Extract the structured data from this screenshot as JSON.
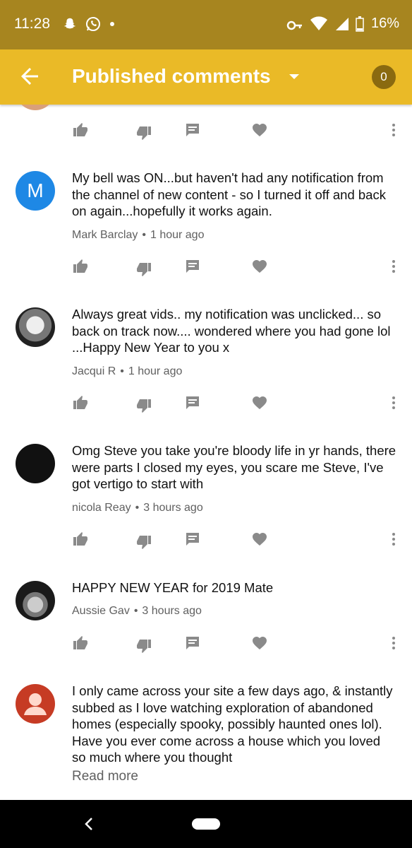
{
  "status_bar": {
    "time": "11:28",
    "battery": "16%"
  },
  "app_bar": {
    "title": "Published comments",
    "count": "0"
  },
  "comments": [
    {
      "initial": "M",
      "text": "My bell was ON...but haven't had any notification from the channel of new content - so I turned it off and back on again...hopefully it works again.",
      "author": "Mark Barclay",
      "time": "1 hour ago"
    },
    {
      "text": "Always great vids.. my notification was unclicked... so back on track now.... wondered where you had gone lol ...Happy New Year to you x",
      "author": "Jacqui R",
      "time": "1 hour ago"
    },
    {
      "text": "Omg Steve you take you're bloody life in yr hands, there were parts I closed my eyes, you scare me Steve, I've got vertigo to start with",
      "author": "nicola Reay",
      "time": "3 hours ago"
    },
    {
      "text": "HAPPY NEW YEAR  for 2019 Mate",
      "author": "Aussie Gav",
      "time": "3 hours ago"
    },
    {
      "text": "I only came across your site a few days ago, & instantly subbed as I love watching exploration of abandoned homes (especially spooky, possibly haunted ones lol). Have you ever come across a house which you loved so much where you thought",
      "read_more": "Read more"
    }
  ],
  "colors": {
    "status_bar": "#a7851f",
    "app_bar": "#eaba27",
    "icon_gray": "#8a8a8a"
  }
}
